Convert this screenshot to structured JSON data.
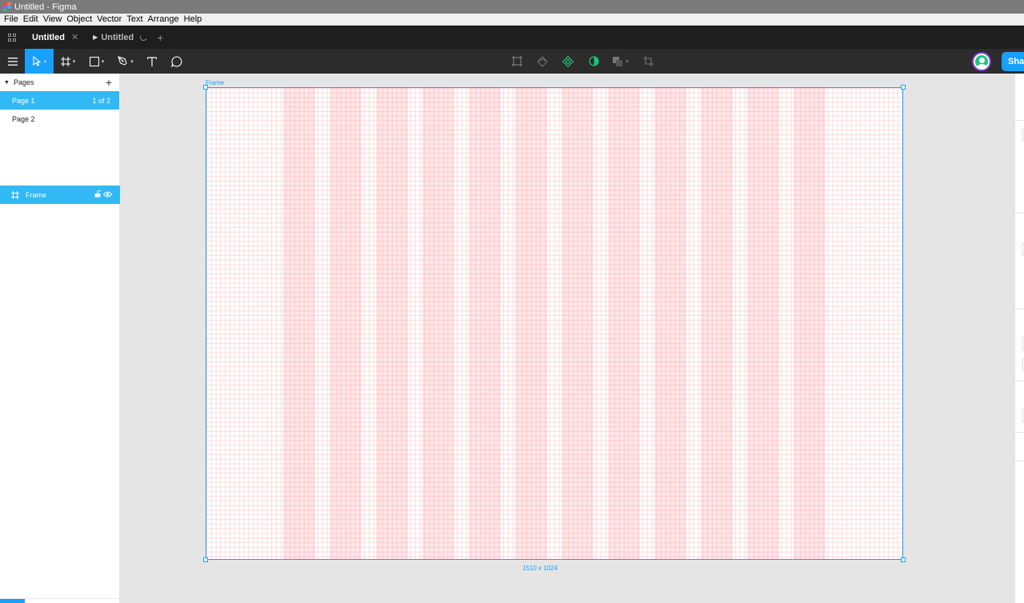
{
  "window": {
    "title": "Untitled - Figma"
  },
  "menu": [
    "File",
    "Edit",
    "View",
    "Object",
    "Vector",
    "Text",
    "Arrange",
    "Help"
  ],
  "tabs": [
    {
      "label": "Untitled",
      "active": true,
      "close": "✕"
    },
    {
      "label": "Untitled",
      "active": false,
      "prototype": true
    }
  ],
  "tab_add": "+",
  "toolbar": {
    "tools": [
      "main-menu",
      "move",
      "frame",
      "shape",
      "pen",
      "text",
      "comment"
    ],
    "center_tools": [
      "component-frame",
      "mask",
      "create-component",
      "boolean-contrast",
      "union",
      "crop"
    ],
    "share_label": "Share",
    "accent": "#18a0fb"
  },
  "pages": {
    "header": "Pages",
    "add": "+",
    "items": [
      {
        "label": "Page 1",
        "selected": true,
        "count": "1 of 2"
      },
      {
        "label": "Page 2",
        "selected": false
      }
    ]
  },
  "layers": [
    {
      "label": "Frame",
      "selected": true
    }
  ],
  "canvas": {
    "frame_label": "Frame",
    "dimensions": "1510 x 1024",
    "columns": 12
  }
}
